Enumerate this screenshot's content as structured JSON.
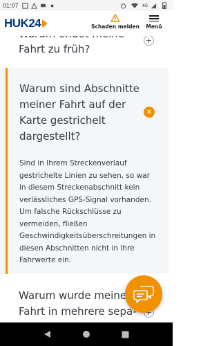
{
  "status_bar": {
    "time": "01:07",
    "network": "4G"
  },
  "header": {
    "logo_text": "HUK24",
    "report_label": "Schaden melden",
    "menu_label": "Menü"
  },
  "faq": {
    "previous_question": "Warum endet meine Fahrt zu früh?",
    "open_question": "Warum sind Abschnitte meiner Fahrt auf der Karte gestrichelt darge­stellt?",
    "open_answer": "Sind in Ihrem Streckenverlauf gestrichelte Linien zu sehen, so war in diesem Streckenabschnitt kein verlässliches GPS-Signal vorhanden. Um falsche Rückschlüsse zu vermeiden, fließen Geschwindigkeitsüberschreitungen in diesen Abschnitten nicht in Ihre Fahrwerte ein.",
    "next_question": "Warum wurde meine Fahrt in mehrere sepa- rate Fahrten aufgeteilt?"
  },
  "icons": {
    "warning": "warning-triangle-icon",
    "menu": "hamburger-icon",
    "expand": "plus-icon",
    "collapse": "close-icon",
    "chat": "chat-bubbles-icon"
  },
  "colors": {
    "brand_blue": "#003781",
    "accent_orange": "#f29100",
    "text": "#333a42",
    "panel_bg": "#f5f6f7"
  }
}
